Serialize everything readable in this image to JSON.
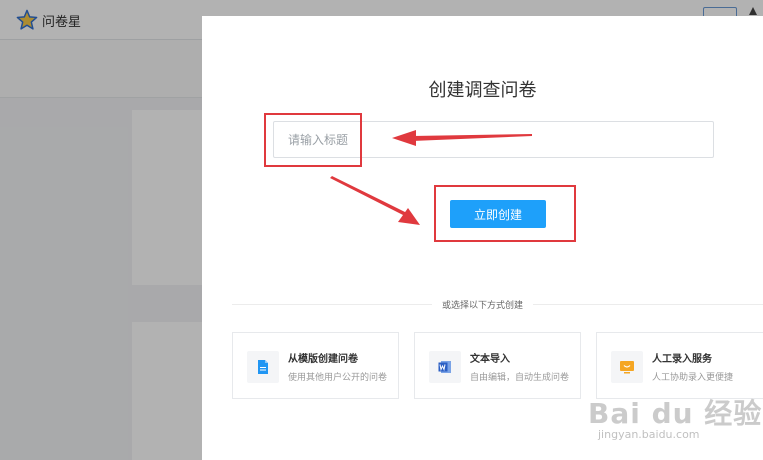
{
  "app": {
    "brand": "问卷星",
    "logo_icon": "star-icon"
  },
  "modal": {
    "title": "创建调查问卷",
    "title_input": {
      "placeholder": "请输入标题",
      "value": ""
    },
    "create_button": "立即创建",
    "divider_text": "或选择以下方式创建",
    "options": [
      {
        "title": "从模版创建问卷",
        "desc": "使用其他用户公开的问卷",
        "icon": "document-icon",
        "color": "#2196f3"
      },
      {
        "title": "文本导入",
        "desc": "自由编辑，自动生成问卷",
        "icon": "word-icon",
        "color": "#2b5fc4"
      },
      {
        "title": "人工录入服务",
        "desc": "人工协助录入更便捷",
        "icon": "monitor-icon",
        "color": "#f5a623"
      }
    ]
  },
  "watermark": {
    "main": "Bai du 经验",
    "sub": "jingyan.baidu.com"
  },
  "colors": {
    "primary": "#1ea0fa",
    "annotation": "#e0393e"
  }
}
